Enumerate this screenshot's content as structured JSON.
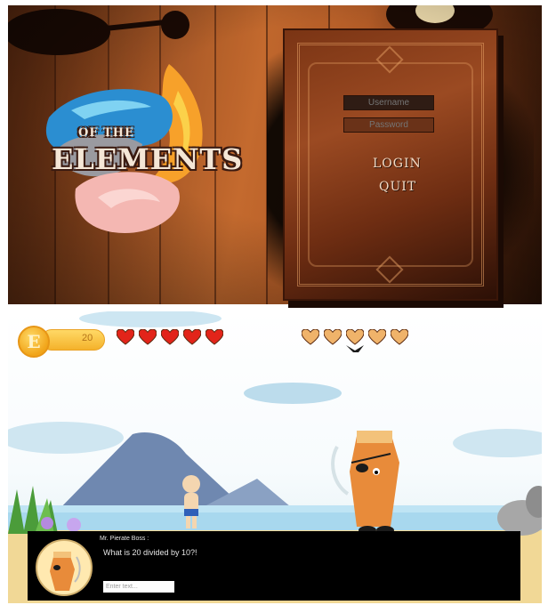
{
  "login": {
    "logo_line1": "OF THE",
    "logo_line2": "ELEMENTS",
    "username_placeholder": "Username",
    "password_placeholder": "Password",
    "login_label": "LOGIN",
    "quit_label": "QUIT"
  },
  "hud": {
    "energy_letter": "E",
    "energy_value": "20",
    "player_hearts": 5,
    "enemy_hearts": 5,
    "player_heart_color": "#e2241a",
    "enemy_heart_color": "#f0b36a"
  },
  "dialog": {
    "speaker": "Mr. Pierate Boss :",
    "question": "What is 20 divided by 10?!",
    "input_placeholder": "Enter text..."
  }
}
